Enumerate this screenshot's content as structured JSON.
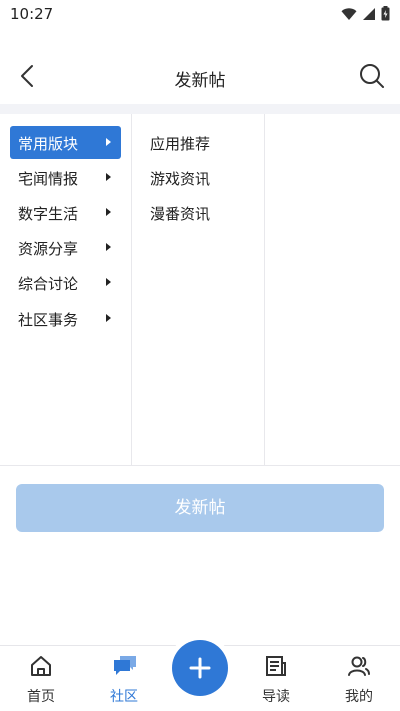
{
  "status_bar": {
    "time": "10:27"
  },
  "header": {
    "title": "发新帖"
  },
  "categories": [
    {
      "label": "常用版块",
      "active": true
    },
    {
      "label": "宅闻情报",
      "active": false
    },
    {
      "label": "数字生活",
      "active": false
    },
    {
      "label": "资源分享",
      "active": false
    },
    {
      "label": "综合讨论",
      "active": false
    },
    {
      "label": "社区事务",
      "active": false
    }
  ],
  "subcategories": [
    "应用推荐",
    "游戏资讯",
    "漫番资讯"
  ],
  "post_button": {
    "label": "发新帖"
  },
  "bottom_nav": [
    {
      "label": "首页",
      "icon": "home-icon"
    },
    {
      "label": "社区",
      "icon": "community-icon",
      "active": true
    },
    {
      "label": "导读",
      "icon": "guide-icon"
    },
    {
      "label": "我的",
      "icon": "profile-icon"
    }
  ],
  "colors": {
    "accent": "#2f78d6",
    "button_disabled": "#a9c9ec",
    "divider": "#e8e8ec",
    "strip": "#f2f3f7"
  }
}
